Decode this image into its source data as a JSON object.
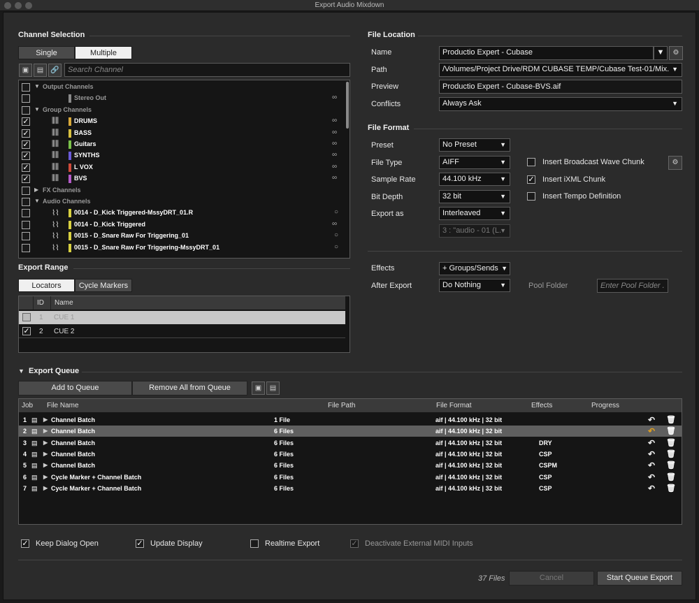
{
  "window": {
    "title": "Export Audio Mixdown"
  },
  "channel_selection": {
    "title": "Channel Selection",
    "modes": [
      "Single",
      "Multiple"
    ],
    "active_mode": "Multiple",
    "search_placeholder": "Search Channel",
    "rows": [
      {
        "kind": "group",
        "label": "Output Channels",
        "checked": false,
        "expanded": true
      },
      {
        "kind": "channel",
        "label": "Stereo Out",
        "checked": false,
        "color": "#8a8a8a",
        "icon": "none",
        "link": "stereo-link-icon",
        "dim": true
      },
      {
        "kind": "group",
        "label": "Group Channels",
        "checked": false,
        "expanded": true
      },
      {
        "kind": "channel",
        "label": "DRUMS",
        "checked": true,
        "color": "#d9a93a",
        "icon": "fader-icon",
        "link": "stereo-link-icon"
      },
      {
        "kind": "channel",
        "label": "BASS",
        "checked": true,
        "color": "#d8c040",
        "icon": "fader-icon",
        "link": "stereo-link-icon"
      },
      {
        "kind": "channel",
        "label": "Guitars",
        "checked": true,
        "color": "#7ac14a",
        "icon": "fader-icon",
        "link": "stereo-link-icon"
      },
      {
        "kind": "channel",
        "label": "SYNTHS",
        "checked": true,
        "color": "#6a5ad8",
        "icon": "fader-icon",
        "link": "stereo-link-icon"
      },
      {
        "kind": "channel",
        "label": "L VOX",
        "checked": true,
        "color": "#d04a3a",
        "icon": "fader-icon",
        "link": "stereo-link-icon"
      },
      {
        "kind": "channel",
        "label": "BVS",
        "checked": true,
        "color": "#b45ac8",
        "icon": "fader-icon",
        "link": "stereo-link-icon"
      },
      {
        "kind": "group",
        "label": "FX Channels",
        "checked": false,
        "expanded": false
      },
      {
        "kind": "group",
        "label": "Audio Channels",
        "checked": false,
        "expanded": true
      },
      {
        "kind": "channel",
        "label": "0014 - D_Kick Triggered-MssyDRT_01.R",
        "checked": false,
        "color": "#d8d040",
        "icon": "waveform-icon",
        "link": "mono-icon"
      },
      {
        "kind": "channel",
        "label": "0014 - D_Kick Triggered",
        "checked": false,
        "color": "#d8d040",
        "icon": "waveform-icon",
        "link": "stereo-link-icon"
      },
      {
        "kind": "channel",
        "label": "0015 - D_Snare Raw For Triggering_01",
        "checked": false,
        "color": "#d8d040",
        "icon": "waveform-icon",
        "link": "mono-icon"
      },
      {
        "kind": "channel",
        "label": "0015 - D_Snare Raw For Triggering-MssyDRT_01",
        "checked": false,
        "color": "#d8d040",
        "icon": "waveform-icon",
        "link": "mono-icon"
      }
    ]
  },
  "export_range": {
    "title": "Export Range",
    "modes": [
      "Locators",
      "Cycle Markers"
    ],
    "active_mode": "Locators",
    "columns": [
      "ID",
      "Name"
    ],
    "rows": [
      {
        "id": "1",
        "name": "CUE 1",
        "checked": false,
        "disabled": true
      },
      {
        "id": "2",
        "name": "CUE 2",
        "checked": true,
        "disabled": false
      }
    ]
  },
  "file_location": {
    "title": "File Location",
    "name_label": "Name",
    "name_value": "Productio Expert - Cubase",
    "path_label": "Path",
    "path_value": "/Volumes/Project Drive/RDM CUBASE TEMP/Cubase Test-01/Mix.",
    "preview_label": "Preview",
    "preview_value": "Productio Expert - Cubase-BVS.aif",
    "conflicts_label": "Conflicts",
    "conflicts_value": "Always Ask"
  },
  "file_format": {
    "title": "File Format",
    "preset_label": "Preset",
    "preset_value": "No Preset",
    "filetype_label": "File Type",
    "filetype_value": "AIFF",
    "samplerate_label": "Sample Rate",
    "samplerate_value": "44.100 kHz",
    "bitdepth_label": "Bit Depth",
    "bitdepth_value": "32 bit",
    "exportas_label": "Export as",
    "exportas_value": "Interleaved",
    "channel_value": "3 : \"audio - 01 (L.",
    "options": [
      {
        "label": "Insert Broadcast Wave Chunk",
        "checked": false
      },
      {
        "label": "Insert iXML Chunk",
        "checked": true
      },
      {
        "label": "Insert Tempo Definition",
        "checked": false
      }
    ]
  },
  "post": {
    "effects_label": "Effects",
    "effects_value": "+ Groups/Sends",
    "after_label": "After Export",
    "after_value": "Do Nothing",
    "pool_label": "Pool Folder",
    "pool_placeholder": "Enter Pool Folder ."
  },
  "export_queue": {
    "title": "Export Queue",
    "add_label": "Add to Queue",
    "remove_label": "Remove All from Queue",
    "columns": [
      "Job",
      "File Name",
      "File Path",
      "File Format",
      "Effects",
      "Progress"
    ],
    "rows": [
      {
        "job": "1",
        "name": "Channel Batch",
        "path": "1 File",
        "format": "aif | 44.100 kHz | 32 bit",
        "effects": "",
        "selected": false
      },
      {
        "job": "2",
        "name": "Channel Batch",
        "path": "6 Files",
        "format": "aif | 44.100 kHz | 32 bit",
        "effects": "",
        "selected": true
      },
      {
        "job": "3",
        "name": "Channel Batch",
        "path": "6 Files",
        "format": "aif | 44.100 kHz | 32 bit",
        "effects": "DRY",
        "selected": false
      },
      {
        "job": "4",
        "name": "Channel Batch",
        "path": "6 Files",
        "format": "aif | 44.100 kHz | 32 bit",
        "effects": "CSP",
        "selected": false
      },
      {
        "job": "5",
        "name": "Channel Batch",
        "path": "6 Files",
        "format": "aif | 44.100 kHz | 32 bit",
        "effects": "CSPM",
        "selected": false
      },
      {
        "job": "6",
        "name": "Cycle Marker + Channel Batch",
        "path": "6 Files",
        "format": "aif | 44.100 kHz | 32 bit",
        "effects": "CSP",
        "selected": false
      },
      {
        "job": "7",
        "name": "Cycle Marker + Channel Batch",
        "path": "6 Files",
        "format": "aif | 44.100 kHz | 32 bit",
        "effects": "CSP",
        "selected": false
      }
    ]
  },
  "footer": {
    "keep_open_label": "Keep Dialog Open",
    "keep_open_checked": true,
    "update_display_label": "Update Display",
    "update_display_checked": true,
    "realtime_label": "Realtime Export",
    "realtime_checked": false,
    "deactivate_midi_label": "Deactivate External MIDI Inputs",
    "deactivate_midi_checked": true,
    "files_count": "37 Files",
    "cancel_label": "Cancel",
    "start_label": "Start Queue Export"
  },
  "colors": {
    "background": "#2b2b2b",
    "selected_row": "#5f5f5f",
    "undo_active": "#e0a020"
  }
}
